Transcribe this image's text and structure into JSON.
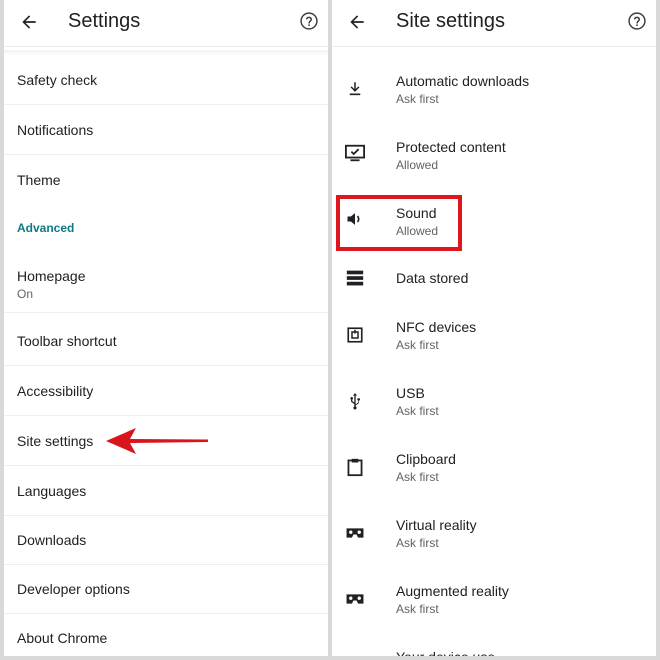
{
  "left": {
    "title": "Settings",
    "items": [
      {
        "label": "Safety check"
      },
      {
        "label": "Notifications"
      },
      {
        "label": "Theme"
      }
    ],
    "advanced_label": "Advanced",
    "homepage": {
      "label": "Homepage",
      "value": "On"
    },
    "items2": [
      {
        "label": "Toolbar shortcut"
      },
      {
        "label": "Accessibility"
      },
      {
        "label": "Site settings"
      },
      {
        "label": "Languages"
      },
      {
        "label": "Downloads"
      },
      {
        "label": "Developer options"
      },
      {
        "label": "About Chrome"
      }
    ]
  },
  "right": {
    "title": "Site settings",
    "items": [
      {
        "label": "Automatic downloads",
        "sub": "Ask first",
        "icon": "download-icon"
      },
      {
        "label": "Protected content",
        "sub": "Allowed",
        "icon": "protected-content-icon"
      },
      {
        "label": "Sound",
        "sub": "Allowed",
        "icon": "speaker-icon"
      },
      {
        "label": "Data stored",
        "sub": "",
        "icon": "storage-icon"
      },
      {
        "label": "NFC devices",
        "sub": "Ask first",
        "icon": "nfc-icon"
      },
      {
        "label": "USB",
        "sub": "Ask first",
        "icon": "usb-icon"
      },
      {
        "label": "Clipboard",
        "sub": "Ask first",
        "icon": "clipboard-icon"
      },
      {
        "label": "Virtual reality",
        "sub": "Ask first",
        "icon": "vr-headset-icon"
      },
      {
        "label": "Augmented reality",
        "sub": "Ask first",
        "icon": "ar-headset-icon"
      },
      {
        "label": "Your device use",
        "sub": "",
        "icon": ""
      }
    ]
  },
  "colors": {
    "accent": "#0d7b84",
    "highlight": "#e0161f",
    "text": "#202124",
    "secondary": "#5f6368"
  }
}
